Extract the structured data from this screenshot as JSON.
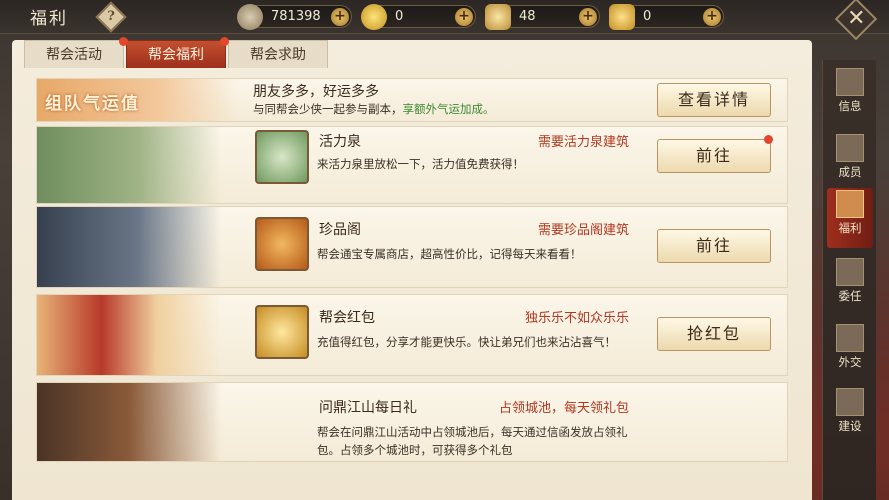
{
  "header": {
    "title": "福利",
    "help_label": "?",
    "resources": [
      {
        "name": "copper-coin",
        "value": "781398",
        "color": "#b7a685"
      },
      {
        "name": "gold-coin",
        "value": "0",
        "color": "#e5c144"
      },
      {
        "name": "silver-ingot",
        "value": "48",
        "color": "#e7c87a"
      },
      {
        "name": "gold-ingot",
        "value": "0",
        "color": "#e9c45a"
      }
    ],
    "plus_label": "+",
    "close_label": "✕"
  },
  "tabs": [
    {
      "label": "帮会活动",
      "active": false
    },
    {
      "label": "帮会福利",
      "active": true
    },
    {
      "label": "帮会求助",
      "active": false
    }
  ],
  "banner": {
    "image_text": "组队气运值",
    "title": "朋友多多，好运多多",
    "desc_prefix": "与同帮会少侠一起参与副本，",
    "desc_highlight": "享额外气运加成。",
    "button": "查看详情"
  },
  "rows": [
    {
      "title": "活力泉",
      "requirement": "需要活力泉建筑",
      "desc": "来活力泉里放松一下，活力值免费获得！",
      "button": "前往",
      "has_dot": true,
      "icon": "potion-bottle-icon"
    },
    {
      "title": "珍品阁",
      "requirement": "需要珍品阁建筑",
      "desc": "帮会通宝专属商店，超高性价比，记得每天来看看！",
      "button": "前往",
      "has_dot": false,
      "icon": "treasure-chest-icon"
    },
    {
      "title": "帮会红包",
      "requirement": "独乐乐不如众乐乐",
      "desc": "充值得红包，分享才能更快乐。快让弟兄们也来沾沾喜气！",
      "button": "抢红包",
      "has_dot": false,
      "icon": "gold-ingot-icon"
    },
    {
      "title": "问鼎江山每日礼",
      "requirement": "占领城池，每天领礼包",
      "desc": "帮会在问鼎江山活动中占领城池后，每天通过信函发放占领礼包。占领多个城池时，可获得多个礼包",
      "button": "",
      "has_dot": false,
      "icon": ""
    }
  ],
  "sidebar": [
    {
      "label": "信息",
      "active": false
    },
    {
      "label": "成员",
      "active": false
    },
    {
      "label": "福利",
      "active": true
    },
    {
      "label": "委任",
      "active": false
    },
    {
      "label": "外交",
      "active": false
    },
    {
      "label": "建设",
      "active": false
    }
  ]
}
